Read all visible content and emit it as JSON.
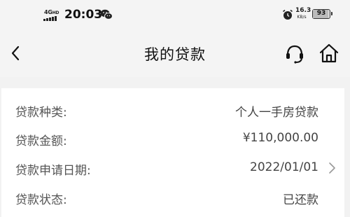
{
  "status_bar": {
    "network": "4G",
    "network_sup": "HD",
    "time": "20:03",
    "net_speed_value": "16.3",
    "net_speed_unit": "KB/s",
    "battery_level": "93",
    "icons": [
      "signal-icon",
      "wechat-icon",
      "alarm-icon",
      "battery-icon"
    ]
  },
  "header": {
    "title": "我的贷款",
    "icons": [
      "back-chevron-icon",
      "customer-service-headset-icon",
      "home-icon"
    ]
  },
  "loan_details": {
    "rows": [
      {
        "label": "贷款种类:",
        "value": "个人一手房贷款"
      },
      {
        "label": "贷款金额:",
        "value": "¥110,000.00"
      },
      {
        "label": "贷款申请日期:",
        "value": "2022/01/01"
      },
      {
        "label": "贷款状态:",
        "value": "已还款"
      }
    ]
  },
  "colors": {
    "background": "#f2f2f2",
    "card": "#ffffff",
    "text_primary": "#111111",
    "text_secondary": "#555555"
  }
}
